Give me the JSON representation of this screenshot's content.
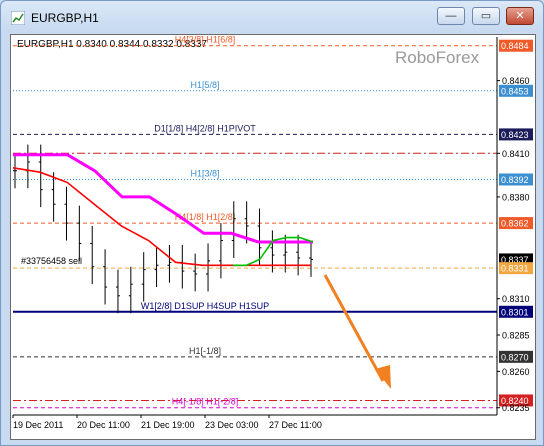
{
  "window": {
    "title": "EURGBP,H1",
    "buttons": {
      "minimize": "—",
      "maximize": "▭",
      "close": "✕"
    }
  },
  "chart_header": "EURGBP,H1  0.8340 0.8344 0.8332 0.8337",
  "watermark": "RoboForex",
  "order_label": "#33756458 sell",
  "levels": [
    {
      "label": "H4[3/8] H1[6/8]",
      "price": "0.8484",
      "color": "#f05a28",
      "style": "dash",
      "tag_bg": "#f05a28"
    },
    {
      "label": "",
      "price": "0.8460",
      "color": "",
      "style": "none",
      "tag_bg": ""
    },
    {
      "label": "H1[5/8]",
      "price": "0.8453",
      "color": "#3b8fd0",
      "style": "dot",
      "tag_bg": "#3b8fd0"
    },
    {
      "label": "D1[1/8] H4[2/8] H1PIVOT",
      "price": "0.8423",
      "color": "#1c1c5a",
      "style": "dash",
      "tag_bg": "#1c1c5a"
    },
    {
      "label": "",
      "price": "0.8410",
      "color": "#d42020",
      "style": "dashdot",
      "tag_bg": ""
    },
    {
      "label": "H1[3/8]",
      "price": "0.8392",
      "color": "#3b8fd0",
      "style": "dot",
      "tag_bg": "#3b8fd0"
    },
    {
      "label": "",
      "price": "0.8380",
      "color": "",
      "style": "none",
      "tag_bg": ""
    },
    {
      "label": "H4[1/8] H1[2/8]",
      "price": "0.8362",
      "color": "#f05a28",
      "style": "dash",
      "tag_bg": "#f05a28"
    },
    {
      "label": "",
      "price": "0.8337",
      "color": "#000000",
      "style": "none",
      "tag_bg": "#000000"
    },
    {
      "label": "",
      "price": "0.8331",
      "color": "#f2a640",
      "style": "dash",
      "tag_bg": "#f2a640"
    },
    {
      "label": "",
      "price": "0.8310",
      "color": "",
      "style": "none",
      "tag_bg": ""
    },
    {
      "label": "W1[2/8] D1SUP H4SUP H1SUP",
      "price": "0.8301",
      "color": "#00007a",
      "style": "solid",
      "tag_bg": "#00007a"
    },
    {
      "label": "",
      "price": "0.8285",
      "color": "",
      "style": "none",
      "tag_bg": ""
    },
    {
      "label": "H1[-1/8]",
      "price": "0.8270",
      "color": "#333333",
      "style": "dash",
      "tag_bg": "#333333"
    },
    {
      "label": "",
      "price": "0.8260",
      "color": "",
      "style": "none",
      "tag_bg": ""
    },
    {
      "label": "",
      "price": "0.8240",
      "color": "#d42020",
      "style": "dashdot",
      "tag_bg": "#d42020"
    },
    {
      "label": "H4[-1/8] H1[-2/8]",
      "price": "0.8235",
      "color": "#d400d4",
      "style": "dash",
      "tag_bg": ""
    }
  ],
  "x_labels": [
    "19 Dec 2011",
    "20 Dec 11:00",
    "21 Dec 19:00",
    "23 Dec 03:00",
    "27 Dec 11:00"
  ],
  "chart_data": {
    "type": "line",
    "symbol": "EURGBP",
    "timeframe": "H1",
    "ohlc_last": {
      "open": 0.834,
      "high": 0.8344,
      "low": 0.8332,
      "close": 0.8337
    },
    "ylim": [
      0.823,
      0.849
    ],
    "series": [
      {
        "color": "#ff00ff",
        "values": [
          0.8409,
          0.8409,
          0.8409,
          0.8398,
          0.838,
          0.838,
          0.8368,
          0.8355,
          0.8355,
          0.8349,
          0.8349,
          0.8349
        ]
      },
      {
        "color": "#ff0000",
        "values": [
          0.84,
          0.8397,
          0.839,
          0.8375,
          0.836,
          0.835,
          0.8335,
          0.8333,
          0.8333,
          0.8333,
          0.8333,
          0.8333
        ]
      },
      {
        "color": "#00c000",
        "values": [
          0.8333,
          0.8333,
          0.8337,
          0.835,
          0.8352,
          0.8352,
          0.8349
        ]
      }
    ],
    "bars_close": [
      0.8398,
      0.8404,
      0.8385,
      0.8375,
      0.8362,
      0.8348,
      0.8332,
      0.8318,
      0.8312,
      0.832,
      0.833,
      0.8333,
      0.8335,
      0.8329,
      0.8327,
      0.8336,
      0.835,
      0.8365,
      0.836,
      0.8345,
      0.834,
      0.8342,
      0.8338,
      0.8337
    ]
  },
  "annotation_arrow": {
    "color": "#f08020"
  }
}
